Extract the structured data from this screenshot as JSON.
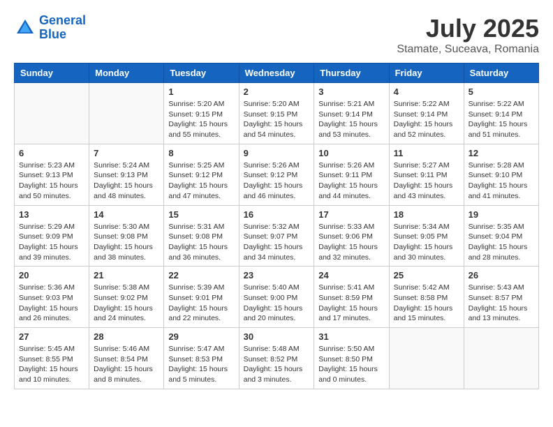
{
  "header": {
    "logo_line1": "General",
    "logo_line2": "Blue",
    "month": "July 2025",
    "location": "Stamate, Suceava, Romania"
  },
  "days_of_week": [
    "Sunday",
    "Monday",
    "Tuesday",
    "Wednesday",
    "Thursday",
    "Friday",
    "Saturday"
  ],
  "weeks": [
    [
      {
        "day": "",
        "info": ""
      },
      {
        "day": "",
        "info": ""
      },
      {
        "day": "1",
        "info": "Sunrise: 5:20 AM\nSunset: 9:15 PM\nDaylight: 15 hours\nand 55 minutes."
      },
      {
        "day": "2",
        "info": "Sunrise: 5:20 AM\nSunset: 9:15 PM\nDaylight: 15 hours\nand 54 minutes."
      },
      {
        "day": "3",
        "info": "Sunrise: 5:21 AM\nSunset: 9:14 PM\nDaylight: 15 hours\nand 53 minutes."
      },
      {
        "day": "4",
        "info": "Sunrise: 5:22 AM\nSunset: 9:14 PM\nDaylight: 15 hours\nand 52 minutes."
      },
      {
        "day": "5",
        "info": "Sunrise: 5:22 AM\nSunset: 9:14 PM\nDaylight: 15 hours\nand 51 minutes."
      }
    ],
    [
      {
        "day": "6",
        "info": "Sunrise: 5:23 AM\nSunset: 9:13 PM\nDaylight: 15 hours\nand 50 minutes."
      },
      {
        "day": "7",
        "info": "Sunrise: 5:24 AM\nSunset: 9:13 PM\nDaylight: 15 hours\nand 48 minutes."
      },
      {
        "day": "8",
        "info": "Sunrise: 5:25 AM\nSunset: 9:12 PM\nDaylight: 15 hours\nand 47 minutes."
      },
      {
        "day": "9",
        "info": "Sunrise: 5:26 AM\nSunset: 9:12 PM\nDaylight: 15 hours\nand 46 minutes."
      },
      {
        "day": "10",
        "info": "Sunrise: 5:26 AM\nSunset: 9:11 PM\nDaylight: 15 hours\nand 44 minutes."
      },
      {
        "day": "11",
        "info": "Sunrise: 5:27 AM\nSunset: 9:11 PM\nDaylight: 15 hours\nand 43 minutes."
      },
      {
        "day": "12",
        "info": "Sunrise: 5:28 AM\nSunset: 9:10 PM\nDaylight: 15 hours\nand 41 minutes."
      }
    ],
    [
      {
        "day": "13",
        "info": "Sunrise: 5:29 AM\nSunset: 9:09 PM\nDaylight: 15 hours\nand 39 minutes."
      },
      {
        "day": "14",
        "info": "Sunrise: 5:30 AM\nSunset: 9:08 PM\nDaylight: 15 hours\nand 38 minutes."
      },
      {
        "day": "15",
        "info": "Sunrise: 5:31 AM\nSunset: 9:08 PM\nDaylight: 15 hours\nand 36 minutes."
      },
      {
        "day": "16",
        "info": "Sunrise: 5:32 AM\nSunset: 9:07 PM\nDaylight: 15 hours\nand 34 minutes."
      },
      {
        "day": "17",
        "info": "Sunrise: 5:33 AM\nSunset: 9:06 PM\nDaylight: 15 hours\nand 32 minutes."
      },
      {
        "day": "18",
        "info": "Sunrise: 5:34 AM\nSunset: 9:05 PM\nDaylight: 15 hours\nand 30 minutes."
      },
      {
        "day": "19",
        "info": "Sunrise: 5:35 AM\nSunset: 9:04 PM\nDaylight: 15 hours\nand 28 minutes."
      }
    ],
    [
      {
        "day": "20",
        "info": "Sunrise: 5:36 AM\nSunset: 9:03 PM\nDaylight: 15 hours\nand 26 minutes."
      },
      {
        "day": "21",
        "info": "Sunrise: 5:38 AM\nSunset: 9:02 PM\nDaylight: 15 hours\nand 24 minutes."
      },
      {
        "day": "22",
        "info": "Sunrise: 5:39 AM\nSunset: 9:01 PM\nDaylight: 15 hours\nand 22 minutes."
      },
      {
        "day": "23",
        "info": "Sunrise: 5:40 AM\nSunset: 9:00 PM\nDaylight: 15 hours\nand 20 minutes."
      },
      {
        "day": "24",
        "info": "Sunrise: 5:41 AM\nSunset: 8:59 PM\nDaylight: 15 hours\nand 17 minutes."
      },
      {
        "day": "25",
        "info": "Sunrise: 5:42 AM\nSunset: 8:58 PM\nDaylight: 15 hours\nand 15 minutes."
      },
      {
        "day": "26",
        "info": "Sunrise: 5:43 AM\nSunset: 8:57 PM\nDaylight: 15 hours\nand 13 minutes."
      }
    ],
    [
      {
        "day": "27",
        "info": "Sunrise: 5:45 AM\nSunset: 8:55 PM\nDaylight: 15 hours\nand 10 minutes."
      },
      {
        "day": "28",
        "info": "Sunrise: 5:46 AM\nSunset: 8:54 PM\nDaylight: 15 hours\nand 8 minutes."
      },
      {
        "day": "29",
        "info": "Sunrise: 5:47 AM\nSunset: 8:53 PM\nDaylight: 15 hours\nand 5 minutes."
      },
      {
        "day": "30",
        "info": "Sunrise: 5:48 AM\nSunset: 8:52 PM\nDaylight: 15 hours\nand 3 minutes."
      },
      {
        "day": "31",
        "info": "Sunrise: 5:50 AM\nSunset: 8:50 PM\nDaylight: 15 hours\nand 0 minutes."
      },
      {
        "day": "",
        "info": ""
      },
      {
        "day": "",
        "info": ""
      }
    ]
  ]
}
